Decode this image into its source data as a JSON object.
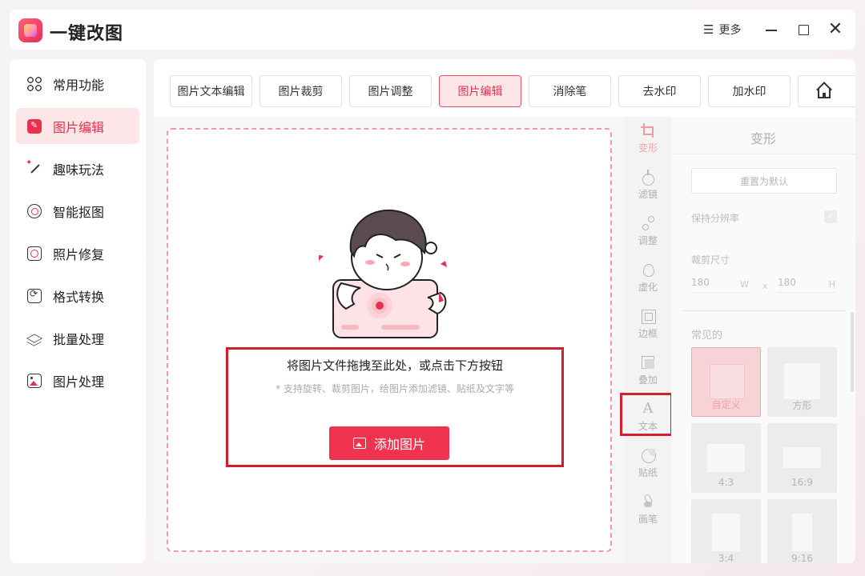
{
  "app": {
    "title": "一键改图",
    "more_label": "更多",
    "more_icon": "menu-icon"
  },
  "sidebar": {
    "items": [
      {
        "label": "常用功能",
        "icon": "grid-icon"
      },
      {
        "label": "图片编辑",
        "icon": "edit-icon",
        "active": true
      },
      {
        "label": "趣味玩法",
        "icon": "magic-wand-icon"
      },
      {
        "label": "智能抠图",
        "icon": "target-icon"
      },
      {
        "label": "照片修复",
        "icon": "repair-icon"
      },
      {
        "label": "格式转换",
        "icon": "convert-icon"
      },
      {
        "label": "批量处理",
        "icon": "layers-icon"
      },
      {
        "label": "图片处理",
        "icon": "image-icon"
      }
    ]
  },
  "tabs": [
    {
      "label": "图片文本编辑"
    },
    {
      "label": "图片裁剪"
    },
    {
      "label": "图片调整"
    },
    {
      "label": "图片编辑",
      "active": true
    },
    {
      "label": "消除笔"
    },
    {
      "label": "去水印"
    },
    {
      "label": "加水印"
    }
  ],
  "drop": {
    "title": "将图片文件拖拽至此处，或点击下方按钮",
    "hint": "* 支持旋转、裁剪图片，给图片添加滤镜、贴纸及文字等",
    "button_label": "添加图片"
  },
  "tools": [
    {
      "label": "变形",
      "icon": "crop-icon",
      "active": true
    },
    {
      "label": "滤镜",
      "icon": "filter-icon"
    },
    {
      "label": "调整",
      "icon": "adjust-icon"
    },
    {
      "label": "虚化",
      "icon": "blur-icon"
    },
    {
      "label": "边框",
      "icon": "border-icon"
    },
    {
      "label": "叠加",
      "icon": "overlay-icon"
    },
    {
      "label": "文本",
      "icon": "text-icon",
      "glyph": "A"
    },
    {
      "label": "贴纸",
      "icon": "sticker-icon"
    },
    {
      "label": "画笔",
      "icon": "brush-icon"
    }
  ],
  "settings": {
    "title": "变形",
    "reset_label": "重置为默认",
    "keep_resolution_label": "保持分辨率",
    "keep_resolution_checked": true,
    "crop_size_label": "裁剪尺寸",
    "width_value": "180",
    "width_unit": "W",
    "height_value": "180",
    "height_unit": "H",
    "times_symbol": "x",
    "common_label": "常见的",
    "presets": [
      {
        "label": "自定义",
        "active": true
      },
      {
        "label": "方形"
      },
      {
        "label": "4:3"
      },
      {
        "label": "16:9"
      },
      {
        "label": "3:4"
      },
      {
        "label": "9:16"
      }
    ]
  },
  "colors": {
    "accent": "#f0334f",
    "accent_light": "#fde6e8",
    "highlight_box": "#d21f2b"
  }
}
